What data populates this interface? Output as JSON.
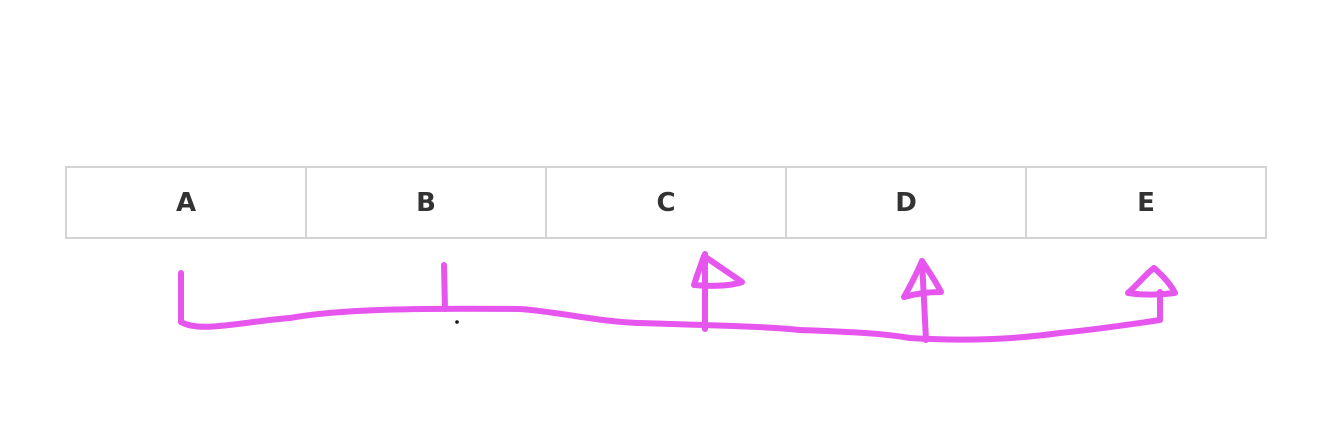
{
  "cells": [
    "A",
    "B",
    "C",
    "D",
    "E"
  ],
  "colors": {
    "cell_border": "#d3d3d3",
    "cell_text": "#333333",
    "ink": "#e655ee"
  },
  "annotation": {
    "kind": "hand-drawn bracket with upward arrows under cells C, D and E",
    "arrows_on_cells": [
      "C",
      "D",
      "E"
    ]
  }
}
